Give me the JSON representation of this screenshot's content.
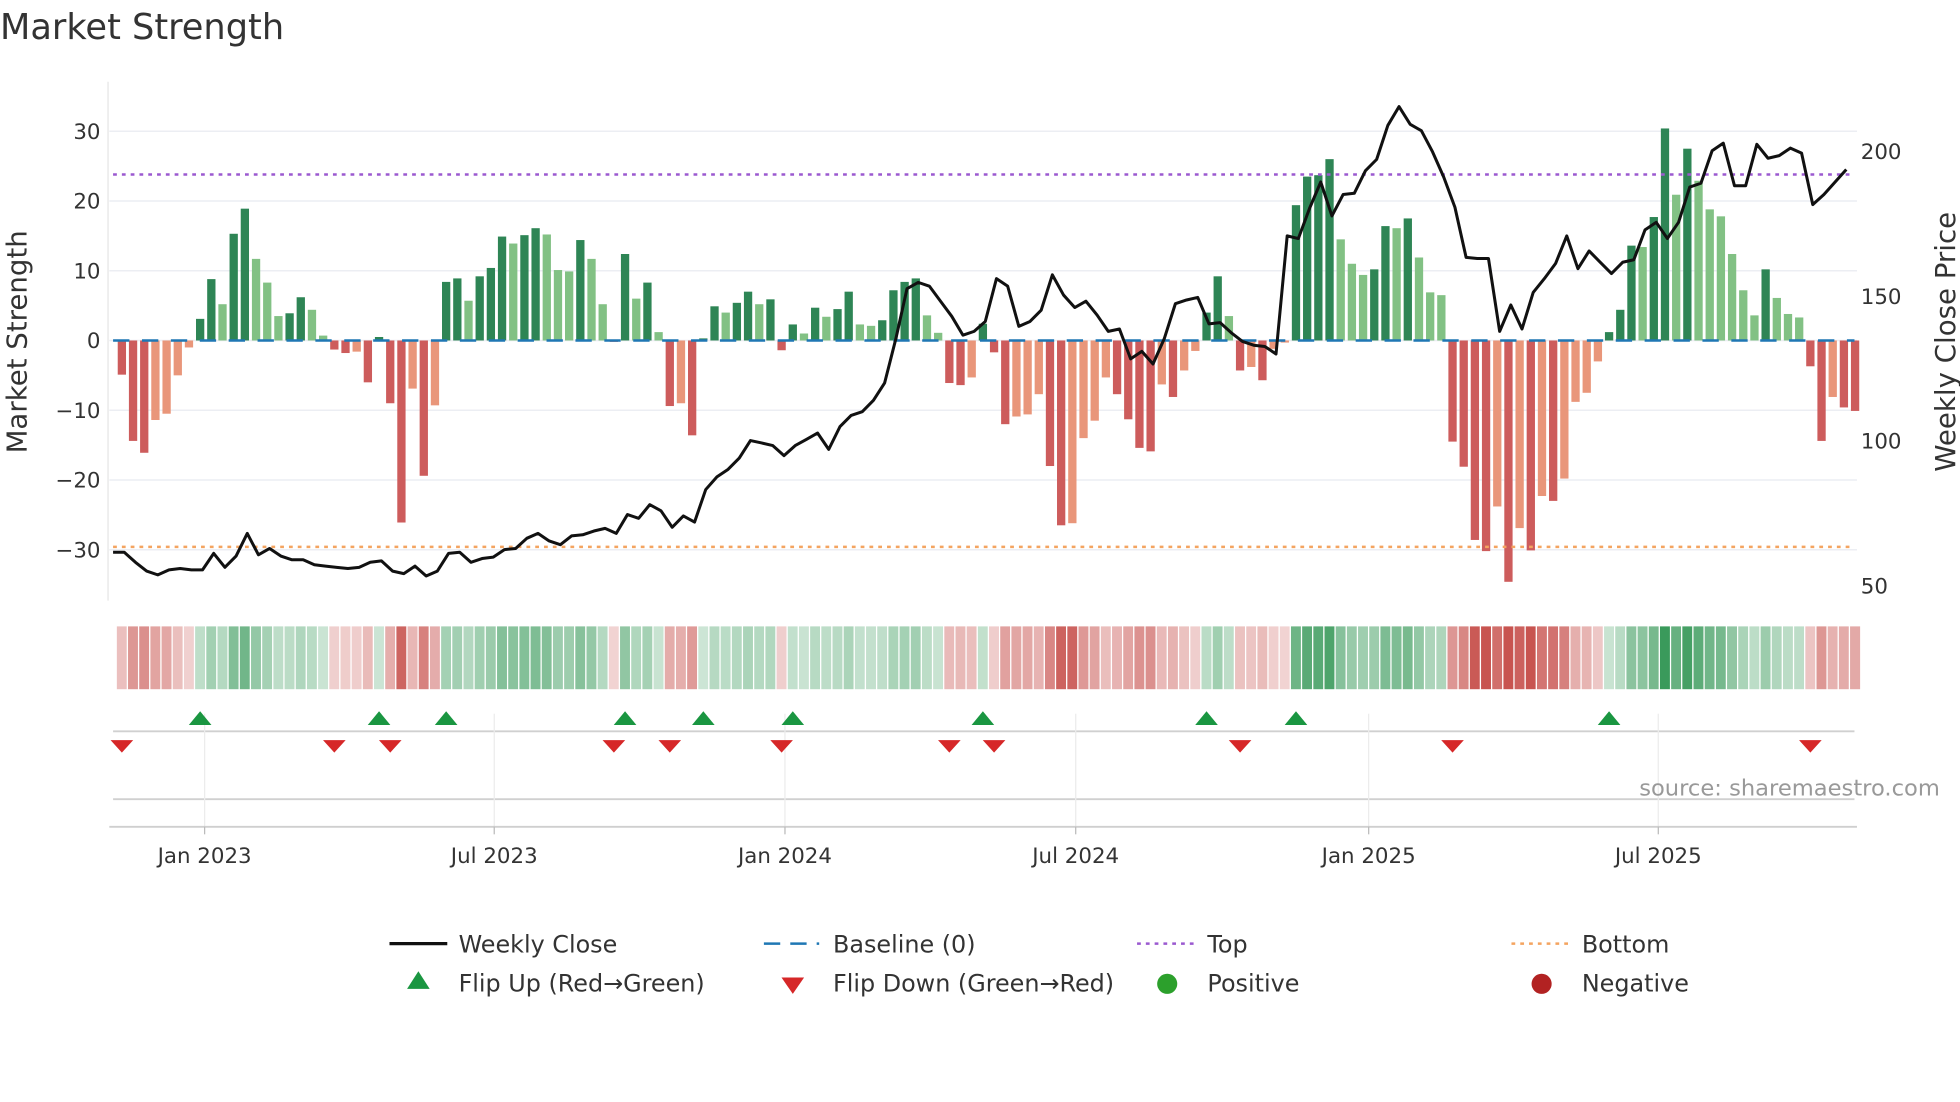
{
  "chart_data": {
    "type": "bar",
    "title": "Market Strength",
    "ylabel": "Market Strength",
    "y2label": "Weekly Close Price",
    "ylim": [
      -37.3,
      37.1
    ],
    "y2lim": [
      45,
      224
    ],
    "yticks": [
      30,
      20,
      10,
      0,
      -10,
      -20,
      -30
    ],
    "ytick_labels": [
      "30",
      "20",
      "10",
      "0",
      "−10",
      "−20",
      "−30"
    ],
    "y2ticks": [
      200,
      150,
      100,
      50
    ],
    "y2tick_labels": [
      "200",
      "150",
      "100",
      "50"
    ],
    "x_unit": "week index (weekly bars, first bar mid-Nov 2022)",
    "xticks": [
      {
        "label": "Jan 2023",
        "week": 7.4
      },
      {
        "label": "Jul 2023",
        "week": 33.3
      },
      {
        "label": "Jan 2024",
        "week": 59.3
      },
      {
        "label": "Jul 2024",
        "week": 85.3
      },
      {
        "label": "Jan 2025",
        "week": 111.5
      },
      {
        "label": "Jul 2025",
        "week": 137.4
      }
    ],
    "top_level": 23.8,
    "bottom_level": -29.6,
    "baseline": 0,
    "strength": [
      -4.9,
      -14.4,
      -16.1,
      -11.4,
      -10.5,
      -5.0,
      -1.0,
      3.1,
      8.8,
      5.2,
      15.3,
      18.9,
      11.7,
      8.3,
      3.5,
      3.9,
      6.2,
      4.4,
      0.7,
      -1.3,
      -1.8,
      -1.6,
      -6.0,
      0.5,
      -9.0,
      -26.1,
      -6.9,
      -19.4,
      -9.3,
      8.4,
      8.9,
      5.7,
      9.2,
      10.4,
      14.9,
      13.9,
      15.1,
      16.1,
      15.2,
      10.1,
      9.9,
      14.4,
      11.7,
      5.2,
      -0.2,
      12.4,
      6.0,
      8.3,
      1.2,
      -9.4,
      -9.0,
      -13.6,
      0.3,
      4.9,
      4.0,
      5.4,
      7.0,
      5.2,
      5.9,
      -1.4,
      2.3,
      1.0,
      4.7,
      3.4,
      4.5,
      7.0,
      2.3,
      2.1,
      2.9,
      7.2,
      8.4,
      8.9,
      3.6,
      1.1,
      -6.1,
      -6.4,
      -5.3,
      2.4,
      -1.7,
      -12.0,
      -10.9,
      -10.6,
      -7.7,
      -18.0,
      -26.5,
      -26.2,
      -14.0,
      -11.5,
      -5.3,
      -7.7,
      -11.3,
      -15.4,
      -15.9,
      -6.3,
      -8.1,
      -4.3,
      -1.5,
      4.0,
      9.2,
      3.5,
      -4.3,
      -3.8,
      -5.7,
      -1.2,
      -0.3,
      19.4,
      23.5,
      23.7,
      26.0,
      14.5,
      11.0,
      9.4,
      10.2,
      16.4,
      16.1,
      17.5,
      11.9,
      6.9,
      6.5,
      -14.5,
      -18.1,
      -28.6,
      -30.2,
      -23.8,
      -34.6,
      -26.9,
      -30.1,
      -22.3,
      -23.0,
      -19.8,
      -8.8,
      -7.5,
      -3.0,
      1.2,
      4.4,
      13.6,
      13.4,
      17.7,
      30.4,
      20.9,
      27.5,
      22.9,
      18.8,
      17.8,
      12.4,
      7.2,
      3.6,
      10.2,
      6.1,
      3.8,
      3.3,
      -3.7,
      -14.4,
      -8.1,
      -9.6,
      -10.1
    ],
    "weekly_close": [
      61.7,
      61.7,
      58.2,
      55.2,
      53.9,
      55.6,
      56.1,
      55.6,
      55.6,
      61.3,
      56.5,
      60.4,
      68.2,
      60.8,
      63.0,
      60.4,
      59.1,
      59.1,
      57.4,
      56.9,
      56.5,
      56.1,
      56.5,
      58.2,
      58.7,
      55.2,
      54.3,
      56.9,
      53.5,
      55.2,
      61.3,
      61.7,
      58.2,
      59.5,
      60.0,
      62.6,
      63.0,
      66.5,
      68.2,
      65.6,
      64.3,
      67.3,
      67.7,
      69.0,
      69.9,
      68.2,
      74.7,
      73.4,
      78.1,
      76.0,
      70.3,
      74.2,
      72.1,
      83.3,
      87.7,
      90.3,
      94.2,
      100.2,
      99.4,
      98.5,
      95.0,
      98.5,
      100.6,
      102.8,
      97.2,
      105.0,
      108.9,
      110.2,
      114.1,
      120.1,
      135.3,
      152.6,
      154.8,
      153.5,
      148.3,
      143.1,
      136.6,
      137.9,
      141.3,
      156.1,
      153.5,
      139.6,
      141.3,
      145.2,
      157.4,
      150.4,
      146.1,
      148.3,
      143.5,
      137.9,
      138.7,
      128.4,
      131.0,
      126.6,
      135.3,
      147.4,
      148.7,
      149.6,
      140.5,
      140.9,
      137.4,
      134.4,
      133.1,
      132.7,
      130.1,
      170.8,
      169.9,
      180.3,
      189.4,
      177.7,
      185.1,
      185.5,
      193.3,
      197.2,
      208.9,
      215.4,
      209.3,
      207.1,
      199.8,
      191.1,
      180.7,
      163.4,
      163.0,
      163.0,
      137.9,
      147.0,
      138.7,
      151.3,
      156.1,
      161.3,
      170.8,
      159.5,
      165.6,
      161.7,
      157.8,
      161.7,
      162.6,
      172.9,
      175.5,
      169.9,
      175.5,
      187.7,
      189.0,
      200.2,
      202.8,
      188.1,
      188.1,
      202.4,
      197.6,
      198.5,
      201.1,
      199.4,
      181.6,
      185.1,
      189.4,
      193.7
    ],
    "legend_position": "bottom-center",
    "legend": {
      "weekly_close": "Weekly Close",
      "baseline": "Baseline (0)",
      "top": "Top",
      "bottom": "Bottom",
      "flip_up": "Flip Up (Red→Green)",
      "flip_down": "Flip Down (Green→Red)",
      "positive": "Positive",
      "negative": "Negative"
    },
    "source": "source: sharemaestro.com",
    "colors": {
      "pos_strong": "#2e8555",
      "pos_weak": "#82c184",
      "neg_strong": "#cd5c5c",
      "neg_weak": "#e9967a",
      "baseline": "#1f77b4",
      "top": "#9b59d0",
      "bottom": "#f4a460",
      "line": "#111111",
      "flip_up": "#1a9641",
      "flip_down": "#d62728",
      "positive_dot": "#2ca02c",
      "negative_dot": "#b22222"
    }
  }
}
